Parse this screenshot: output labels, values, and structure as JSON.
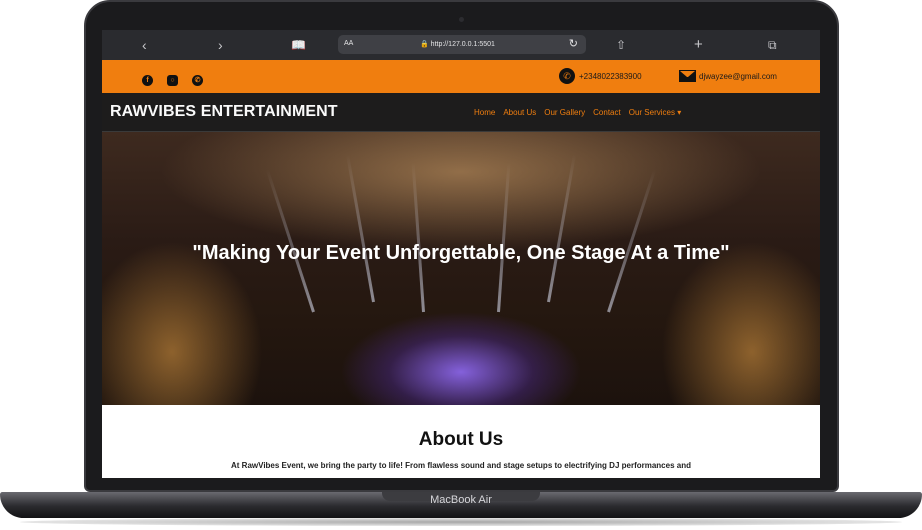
{
  "device": {
    "label": "MacBook Air"
  },
  "browser": {
    "text_size_label": "AA",
    "url": "http://127.0.0.1:5501"
  },
  "topbar": {
    "phone": "+2348022383900",
    "email": "djwayzee@gmail.com",
    "social": [
      "facebook-icon",
      "instagram-icon",
      "whatsapp-icon"
    ]
  },
  "nav": {
    "logo": "RAWVIBES ENTERTAINMENT",
    "items": [
      "Home",
      "About Us",
      "Our Gallery",
      "Contact",
      "Our Services ▾"
    ]
  },
  "hero": {
    "headline": "\"Making Your Event Unforgettable, One Stage At a Time\""
  },
  "about": {
    "title": "About Us",
    "text": "At RawVibes Event, we bring the party to life! From flawless sound and stage setups to electrifying DJ performances and"
  },
  "colors": {
    "accent": "#f07e0f",
    "nav_bg": "#1d1c1c"
  }
}
